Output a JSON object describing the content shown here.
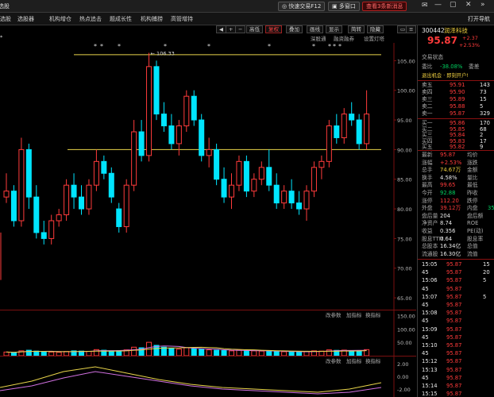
{
  "topbar": {
    "quick_trade": "快速交易F12",
    "multi_window": "多窗口",
    "news": "查看3条新消息",
    "nav_label": "打开导航"
  },
  "menu": [
    "选股",
    "选股器",
    "机构增仓",
    "热点追击",
    "题成长性",
    "机构捕捞",
    "高管增持"
  ],
  "toolbar": {
    "items": [
      "高低",
      "复权",
      "叠加",
      "画线",
      "显示",
      "简转",
      "隐藏"
    ],
    "active": "复权"
  },
  "subbar": {
    "items": [
      "深股通",
      "融资融券",
      "设置灯塔"
    ]
  },
  "main_chart": {
    "max_label": "106.33",
    "price_ticks": [
      "105.00",
      "100.00",
      "95.00",
      "90.00",
      "85.00",
      "80.00",
      "75.00",
      "70.00",
      "65.00"
    ],
    "star_marks": [
      "*",
      "*",
      "*",
      "*",
      "*",
      "*",
      "*",
      "*",
      "*",
      "*",
      "*"
    ]
  },
  "volume_chart": {
    "labels": [
      "改参数",
      "加指标",
      "换指标"
    ],
    "ticks": [
      "150.00",
      "100.00",
      "50.00"
    ]
  },
  "bottom_chart": {
    "labels": [
      "改参数",
      "加指标",
      "换指标"
    ],
    "ticks": [
      "4.00",
      "2.00",
      "0.00",
      "-2.00"
    ]
  },
  "quote": {
    "code": "300442",
    "name": "润泽科技",
    "price": "95.87",
    "change": "+2.37",
    "change_pct": "+2.53%",
    "status": "交易状态",
    "weibi_label": "委比",
    "weibi_value": "-38.08%",
    "weicha_label": "委差",
    "tags": "退出机会 · 即刻开户!",
    "asks": [
      {
        "label": "卖五",
        "price": "95.91",
        "vol": "143"
      },
      {
        "label": "卖四",
        "price": "95.90",
        "vol": "73"
      },
      {
        "label": "卖三",
        "price": "95.89",
        "vol": "15"
      },
      {
        "label": "卖二",
        "price": "95.88",
        "vol": "5"
      },
      {
        "label": "卖一",
        "price": "95.87",
        "vol": "329"
      }
    ],
    "bids": [
      {
        "label": "买一",
        "price": "95.86",
        "vol": "170"
      },
      {
        "label": "买二",
        "price": "95.85",
        "vol": "68"
      },
      {
        "label": "买三",
        "price": "95.84",
        "vol": "2"
      },
      {
        "label": "买四",
        "price": "95.83",
        "vol": "17"
      },
      {
        "label": "买五",
        "price": "95.82",
        "vol": "9"
      }
    ],
    "stats": [
      {
        "l1": "最新",
        "v1": "95.87",
        "c1": "red",
        "l2": "均价",
        "v2": ""
      },
      {
        "l1": "涨幅",
        "v1": "+2.53%",
        "c1": "red",
        "l2": "涨跌",
        "v2": ""
      },
      {
        "l1": "总手",
        "v1": "74.67万",
        "c1": "yellow",
        "l2": "金额",
        "v2": ""
      },
      {
        "l1": "换手",
        "v1": "4.58%",
        "c1": "white",
        "l2": "量比",
        "v2": ""
      },
      {
        "l1": "最高",
        "v1": "99.65",
        "c1": "red",
        "l2": "最低",
        "v2": ""
      },
      {
        "l1": "今开",
        "v1": "92.88",
        "c1": "green",
        "l2": "昨收",
        "v2": ""
      },
      {
        "l1": "涨停",
        "v1": "112.20",
        "c1": "red",
        "l2": "跌停",
        "v2": ""
      },
      {
        "l1": "外盘",
        "v1": "39.12万",
        "c1": "red",
        "l2": "内盘",
        "v2": "35"
      },
      {
        "l1": "盘后量",
        "v1": "204",
        "c1": "white",
        "l2": "盘后额",
        "v2": ""
      },
      {
        "l1": "净资产",
        "v1": "8.74",
        "c1": "white",
        "l2": "ROE",
        "v2": ""
      },
      {
        "l1": "收益",
        "v1": "0.356",
        "c1": "white",
        "l2": "PE(动)",
        "v2": ""
      },
      {
        "l1": "股息TTM",
        "v1": "0.64",
        "c1": "white",
        "l2": "股息率",
        "v2": ""
      },
      {
        "l1": "总股本",
        "v1": "16.34亿",
        "c1": "white",
        "l2": "总值",
        "v2": ""
      },
      {
        "l1": "流通股",
        "v1": "16.30亿",
        "c1": "white",
        "l2": "流值",
        "v2": ""
      }
    ],
    "ticks": [
      {
        "time": "15:05",
        "price": "95.87",
        "vol": "15"
      },
      {
        "time": "45",
        "price": "95.87",
        "vol": "20"
      },
      {
        "time": "15:06",
        "price": "95.87",
        "vol": "5"
      },
      {
        "time": "45",
        "price": "95.87",
        "vol": ""
      },
      {
        "time": "15:07",
        "price": "95.87",
        "vol": "5"
      },
      {
        "time": "45",
        "price": "95.87",
        "vol": ""
      },
      {
        "time": "15:08",
        "price": "95.87",
        "vol": ""
      },
      {
        "time": "45",
        "price": "95.87",
        "vol": ""
      },
      {
        "time": "15:09",
        "price": "95.87",
        "vol": ""
      },
      {
        "time": "45",
        "price": "95.87",
        "vol": ""
      },
      {
        "time": "15:10",
        "price": "95.87",
        "vol": ""
      },
      {
        "time": "45",
        "price": "95.87",
        "vol": ""
      },
      {
        "time": "15:12",
        "price": "95.87",
        "vol": ""
      },
      {
        "time": "15:13",
        "price": "95.87",
        "vol": ""
      },
      {
        "time": "45",
        "price": "95.87",
        "vol": ""
      },
      {
        "time": "15:14",
        "price": "95.87",
        "vol": ""
      },
      {
        "time": "15:15",
        "price": "95.87",
        "vol": ""
      }
    ]
  },
  "colors": {
    "up": "#ff3b3b",
    "down": "#00e5ff",
    "ma_yellow": "#e8d44a",
    "ma_pink": "#d070e0",
    "bg": "#000000"
  },
  "chart_data": {
    "type": "candlestick",
    "ylim": [
      63,
      108
    ],
    "candles": [
      [
        82,
        86,
        81,
        83
      ],
      [
        83,
        84,
        77,
        78
      ],
      [
        78,
        92,
        77,
        90
      ],
      [
        90,
        91,
        80,
        82
      ],
      [
        82,
        84,
        75,
        76
      ],
      [
        76,
        78,
        74,
        75
      ],
      [
        75,
        79,
        74,
        78
      ],
      [
        78,
        80,
        77,
        79
      ],
      [
        79,
        85,
        78,
        84
      ],
      [
        84,
        86,
        80,
        82
      ],
      [
        82,
        84,
        79,
        80
      ],
      [
        80,
        85,
        79,
        84
      ],
      [
        84,
        90,
        83,
        88
      ],
      [
        88,
        89,
        85,
        86
      ],
      [
        86,
        87,
        81,
        82
      ],
      [
        80,
        81,
        76,
        77
      ],
      [
        77,
        85,
        76,
        84
      ],
      [
        84,
        95,
        83,
        93
      ],
      [
        93,
        95,
        88,
        89
      ],
      [
        89,
        106.33,
        88,
        104
      ],
      [
        104,
        105,
        95,
        96
      ],
      [
        96,
        98,
        93,
        94
      ],
      [
        94,
        96,
        90,
        91
      ],
      [
        91,
        95,
        89,
        94
      ],
      [
        94,
        100,
        93,
        99
      ],
      [
        99,
        100,
        94,
        95
      ],
      [
        95,
        96,
        88,
        89
      ],
      [
        89,
        92,
        87,
        90
      ],
      [
        90,
        91,
        84,
        85
      ],
      [
        85,
        87,
        81,
        82
      ],
      [
        82,
        86,
        80,
        84
      ],
      [
        84,
        89,
        83,
        88
      ],
      [
        88,
        89,
        82,
        83
      ],
      [
        83,
        86,
        82,
        85
      ],
      [
        85,
        88,
        84,
        87
      ],
      [
        87,
        90,
        83,
        84
      ],
      [
        84,
        86,
        80,
        81
      ],
      [
        81,
        84,
        80,
        83
      ],
      [
        83,
        85,
        80,
        81
      ],
      [
        81,
        83,
        79,
        80
      ],
      [
        80,
        84,
        78,
        83
      ],
      [
        83,
        88,
        82,
        87
      ],
      [
        87,
        89,
        85,
        88
      ],
      [
        88,
        95,
        87,
        94
      ],
      [
        94,
        96,
        91,
        92
      ],
      [
        92,
        97,
        91,
        96
      ],
      [
        96,
        98,
        94,
        95
      ],
      [
        95,
        96,
        90,
        91
      ],
      [
        91,
        100,
        90,
        96
      ]
    ],
    "volumes": [
      30,
      25,
      40,
      45,
      38,
      32,
      30,
      28,
      35,
      40,
      38,
      36,
      50,
      45,
      40,
      42,
      48,
      70,
      65,
      110,
      85,
      70,
      60,
      55,
      65,
      58,
      52,
      48,
      45,
      42,
      40,
      45,
      42,
      40,
      38,
      36,
      35,
      33,
      32,
      30,
      34,
      40,
      38,
      48,
      44,
      46,
      40,
      42,
      50
    ],
    "resistance_upper": 106,
    "support_line": 90
  }
}
